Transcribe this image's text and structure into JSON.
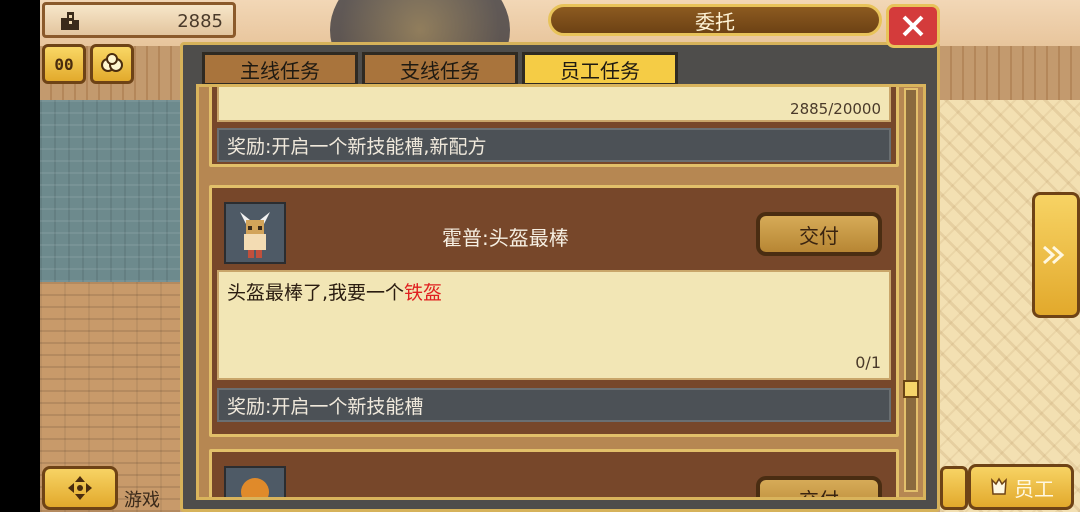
{
  "hud": {
    "money": "2885",
    "icons": [
      "building-icon",
      "pause-icon",
      "gems-icon"
    ],
    "pause_label": "00"
  },
  "dialog": {
    "title": "委托",
    "tabs": [
      "主线任务",
      "支线任务",
      "员工任务"
    ],
    "active_tab": "员工任务"
  },
  "tasks": [
    {
      "progress": "2885/20000",
      "reward": "奖励:开启一个新技能槽,新配方"
    },
    {
      "title": "霍普:头盔最棒",
      "desc_prefix": "头盔最棒了,我要一个",
      "desc_item": "铁盔",
      "progress": "0/1",
      "reward": "奖励:开启一个新技能槽",
      "deliver_label": "交付"
    },
    {
      "title": "",
      "deliver_label": "交付"
    }
  ],
  "bottom": {
    "left_text": "游戏",
    "staff_label": "员工"
  },
  "colors": {
    "highlight_item": "#e02020",
    "tab_active": "#f5cc45",
    "tab_inactive": "#a9743c"
  }
}
